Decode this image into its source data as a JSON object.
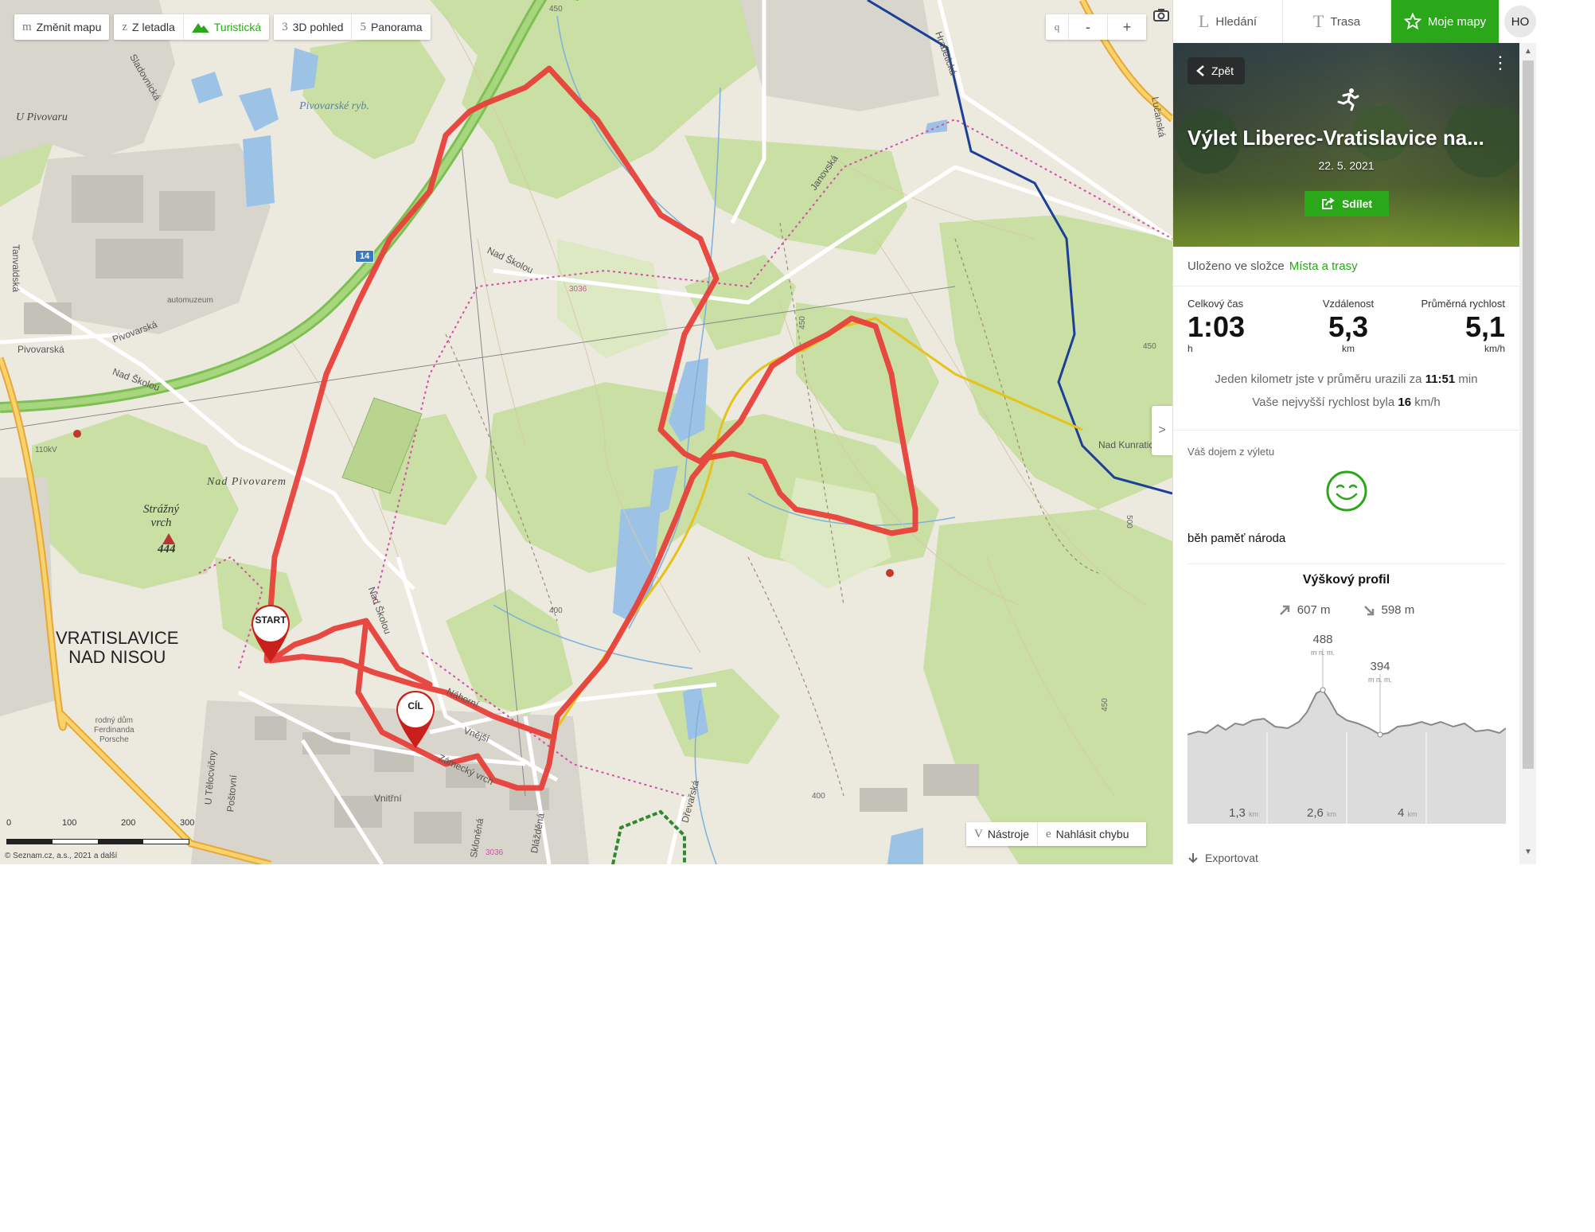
{
  "map": {
    "toolbar": {
      "change_map": {
        "key": "m",
        "label": "Změnit mapu"
      },
      "aerial": {
        "key": "z",
        "label": "Z letadla"
      },
      "tourist": {
        "label": "Turistická"
      },
      "view3d": {
        "key": "3",
        "label": "3D pohled"
      },
      "panorama": {
        "key": "5",
        "label": "Panorama"
      }
    },
    "zoom": {
      "key": "q",
      "minus": "-",
      "plus": "+"
    },
    "collapse": ">",
    "tools": {
      "key": "V",
      "label": "Nástroje"
    },
    "report": {
      "key": "e",
      "label": "Nahlásit chybu"
    },
    "scale": {
      "ticks": [
        "0",
        "100",
        "200",
        "300"
      ]
    },
    "copyright": "© Seznam.cz, a.s., 2021 a další",
    "pins": {
      "start": "START",
      "finish": "CÍL"
    },
    "labels": {
      "town": "VRATISLAVICE\nNAD NISOU",
      "hill_name": "Strážný\nvrch",
      "hill_height": "444",
      "pond": "Pivovarské ryb.",
      "u_pivovaru": "U Pivovaru",
      "nad_pivovarem": "Nad Pivovarem",
      "automuzeum": "automuzeum",
      "rodny_dum": "rodný dům\nFerdinanda\nPorsche",
      "road14": "14",
      "streets": [
        "Sladovnická",
        "Tanvaldská",
        "Pivovarská",
        "Nad Školou",
        "Janovská",
        "Hrabětická",
        "Lučanská",
        "Nad Kunratickou",
        "Náhorní",
        "Vnější",
        "Zámecký vrch",
        "Vnitřní",
        "Dlážděná",
        "Skloněná",
        "Poštovní",
        "U Tělocvičny",
        "Dřevařská",
        "Pivovarská",
        "Zámecký vrch"
      ],
      "cycle_route": "3036",
      "contours": [
        "450",
        "400",
        "450",
        "500",
        "400",
        "450",
        "400"
      ],
      "voltage": "110kV"
    }
  },
  "panel": {
    "tabs": [
      {
        "key": "L",
        "label": "Hledání"
      },
      {
        "key": "T",
        "label": "Trasa"
      },
      {
        "label": "Moje mapy"
      }
    ],
    "user": "HO",
    "back": "Zpět",
    "title": "Výlet Liberec-Vratislavice na...",
    "date": "22. 5. 2021",
    "share": "Sdílet",
    "saved_prefix": "Uloženo ve složce",
    "saved_folder": "Místa a trasy",
    "stats": {
      "time": {
        "label": "Celkový čas",
        "value": "1:03",
        "unit": "h"
      },
      "distance": {
        "label": "Vzdálenost",
        "value": "5,3",
        "unit": "km"
      },
      "speed": {
        "label": "Průměrná rychlost",
        "value": "5,1",
        "unit": "km/h"
      }
    },
    "avg_km_prefix": "Jeden kilometr jste v průměru urazili za",
    "avg_km_value": "11:51",
    "avg_km_unit": "min",
    "max_speed_prefix": "Vaše nejvyšší rychlost byla",
    "max_speed_value": "16",
    "max_speed_unit": "km/h",
    "impression_label": "Váš dojem z výletu",
    "note": "běh paměť národa",
    "elevation": {
      "title": "Výškový profil",
      "ascent": "607 m",
      "descent": "598 m",
      "max_value": "488",
      "max_unit": "m n. m.",
      "min_value": "394",
      "min_unit": "m n. m.",
      "x_ticks": [
        {
          "value": "1,3",
          "unit": "km"
        },
        {
          "value": "2,6",
          "unit": "km"
        },
        {
          "value": "4",
          "unit": "km"
        }
      ]
    },
    "export": "Exportovat"
  },
  "colors": {
    "accent": "#2aa81a",
    "track": "#e8403a",
    "forest": "#c9dfa3",
    "water": "#9cc3e6"
  }
}
